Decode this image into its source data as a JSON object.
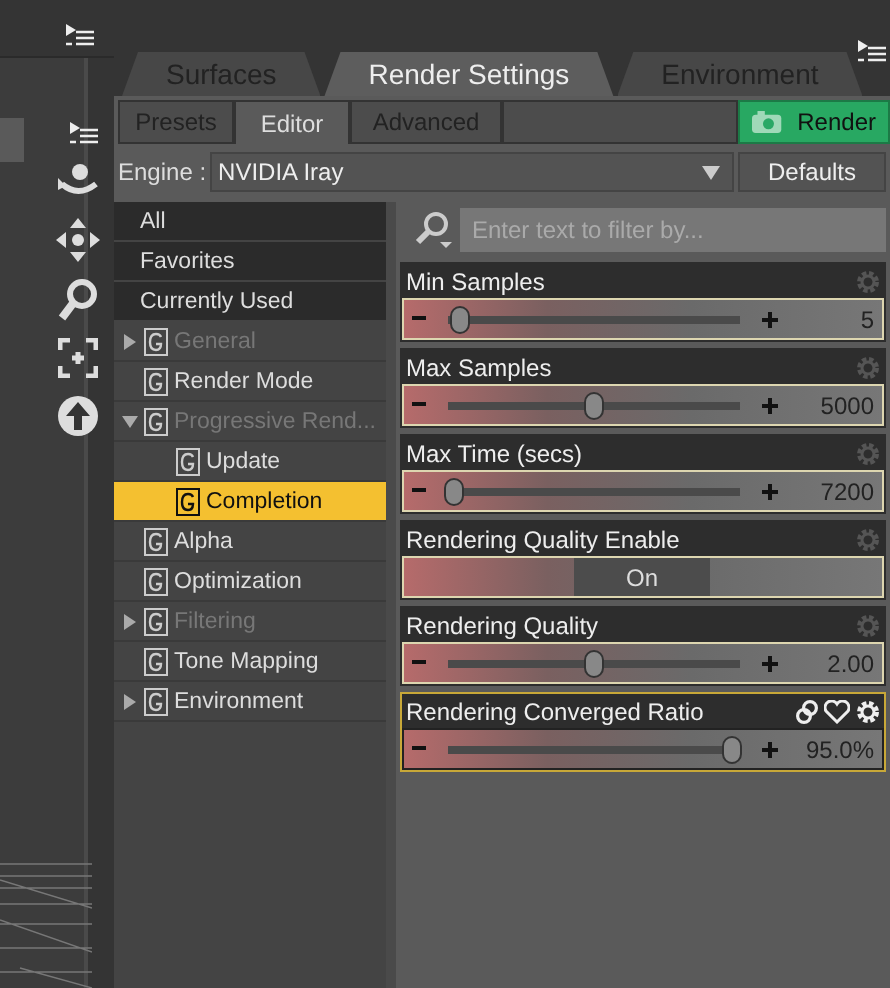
{
  "tabs": [
    {
      "label": "Surfaces",
      "selected": false
    },
    {
      "label": "Render Settings",
      "selected": true
    },
    {
      "label": "Environment",
      "selected": false
    }
  ],
  "subtabs": [
    {
      "label": "Presets",
      "selected": false
    },
    {
      "label": "Editor",
      "selected": true
    },
    {
      "label": "Advanced",
      "selected": false
    }
  ],
  "render_button": "Render",
  "engine": {
    "label": "Engine :",
    "value": "NVIDIA Iray"
  },
  "defaults_button": "Defaults",
  "filters": [
    {
      "label": "All"
    },
    {
      "label": "Favorites"
    },
    {
      "label": "Currently Used"
    }
  ],
  "groups": [
    {
      "label": "General",
      "disabled": true,
      "expanded": false,
      "selected": false
    },
    {
      "label": "Render Mode",
      "disabled": false,
      "selected": false
    },
    {
      "label": "Progressive Rend...",
      "disabled": true,
      "expanded": true,
      "selected": false,
      "children": [
        {
          "label": "Update",
          "disabled": false,
          "selected": false
        },
        {
          "label": "Completion",
          "disabled": false,
          "selected": true
        }
      ]
    },
    {
      "label": "Alpha",
      "disabled": false,
      "selected": false
    },
    {
      "label": "Optimization",
      "disabled": false,
      "selected": false
    },
    {
      "label": "Filtering",
      "disabled": true,
      "expanded": false,
      "selected": false
    },
    {
      "label": "Tone Mapping",
      "disabled": false,
      "selected": false
    },
    {
      "label": "Environment",
      "disabled": false,
      "expanded": false,
      "selected": false
    }
  ],
  "search": {
    "placeholder": "Enter text to filter by..."
  },
  "properties": [
    {
      "kind": "slider",
      "name": "Min Samples",
      "level": 0.04,
      "value": "5",
      "selected": false
    },
    {
      "kind": "slider",
      "name": "Max Samples",
      "level": 0.5,
      "value": "5000",
      "selected": false
    },
    {
      "kind": "slider",
      "name": "Max Time (secs)",
      "level": 0.02,
      "value": "7200",
      "selected": false
    },
    {
      "kind": "toggle",
      "name": "Rendering Quality Enable",
      "value": "On",
      "selected": false
    },
    {
      "kind": "slider",
      "name": "Rendering Quality",
      "level": 0.5,
      "value": "2.00",
      "selected": false
    },
    {
      "kind": "slider",
      "name": "Rendering Converged Ratio",
      "level": 0.97,
      "value": "95.0%",
      "selected": true
    }
  ]
}
